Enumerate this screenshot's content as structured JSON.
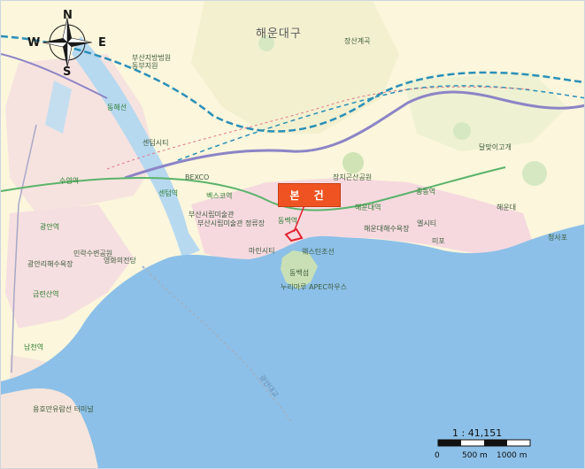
{
  "map": {
    "district_label": "해운대구",
    "callout_label": "본 건",
    "place_labels": [
      "장산계곡",
      "부산지방법원 동부지원",
      "동해선",
      "BEXCO",
      "장지곤산공원",
      "해운대역",
      "부산시립미술관",
      "부산시립미술관 정류장",
      "마린시티",
      "센텀시티",
      "웨스틴조선",
      "동백섬",
      "누리마루 APEC하우스",
      "중동역",
      "해운대해수욕장",
      "미포",
      "달맞이고개",
      "엘시티",
      "수영역",
      "민락수변공원",
      "광안리해수욕장",
      "남천역",
      "금련산역",
      "광안역",
      "용호만유람선 터미널",
      "청사포",
      "벡스코역",
      "센텀역",
      "동백역",
      "영화의전당",
      "해운대",
      "광안대교"
    ],
    "compass": {
      "n": "N",
      "s": "S",
      "e": "E",
      "w": "W"
    },
    "scale": {
      "ratio": "1 : 41,151",
      "ticks": [
        "0",
        "500 m",
        "1000 m"
      ]
    },
    "colors": {
      "land": "#fbf6dc",
      "urban": "#f6d9df",
      "water": "#b7d9f0",
      "sea": "#8cc0e8",
      "park": "#d8e8c4",
      "rail_blue": "#2a8fb8",
      "rail_green": "#5ab36b",
      "road_purple": "#8c84c6",
      "callout": "#f05322",
      "marker": "#e3212d"
    }
  }
}
